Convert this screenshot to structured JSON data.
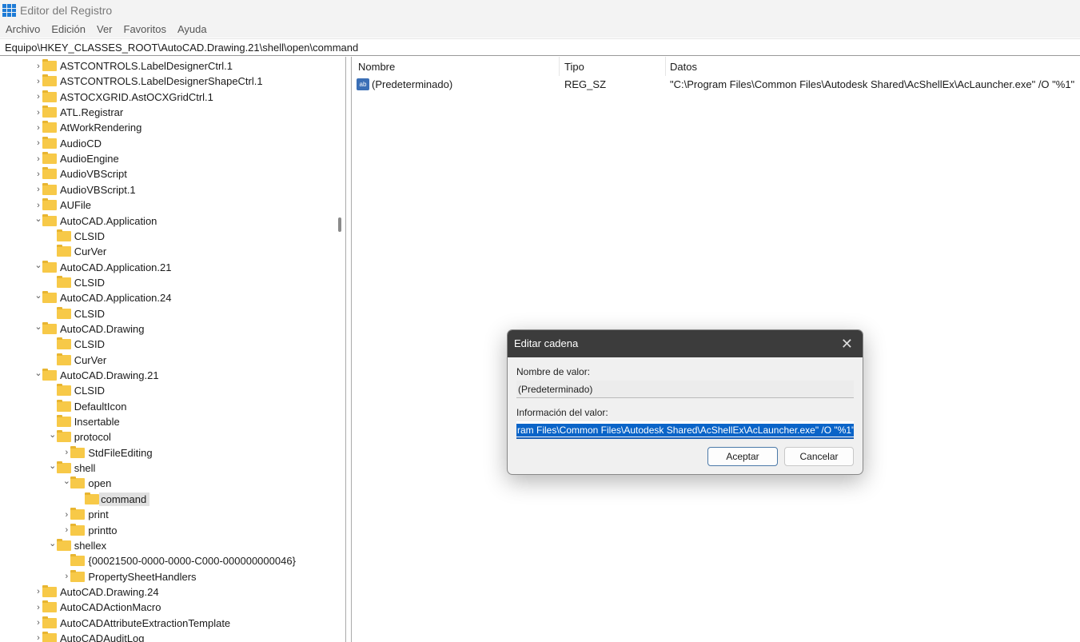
{
  "window": {
    "title": "Editor del Registro",
    "icon": "registry-icon"
  },
  "menu": [
    "Archivo",
    "Edición",
    "Ver",
    "Favoritos",
    "Ayuda"
  ],
  "address": "Equipo\\HKEY_CLASSES_ROOT\\AutoCAD.Drawing.21\\shell\\open\\command",
  "tree": [
    {
      "label": "ASTCONTROLS.LabelDesignerCtrl.1",
      "level": 0,
      "exp": ">"
    },
    {
      "label": "ASTCONTROLS.LabelDesignerShapeCtrl.1",
      "level": 0,
      "exp": ">"
    },
    {
      "label": "ASTOCXGRID.AstOCXGridCtrl.1",
      "level": 0,
      "exp": ">"
    },
    {
      "label": "ATL.Registrar",
      "level": 0,
      "exp": ">"
    },
    {
      "label": "AtWorkRendering",
      "level": 0,
      "exp": ">"
    },
    {
      "label": "AudioCD",
      "level": 0,
      "exp": ">"
    },
    {
      "label": "AudioEngine",
      "level": 0,
      "exp": ">"
    },
    {
      "label": "AudioVBScript",
      "level": 0,
      "exp": ">"
    },
    {
      "label": "AudioVBScript.1",
      "level": 0,
      "exp": ">"
    },
    {
      "label": "AUFile",
      "level": 0,
      "exp": ">"
    },
    {
      "label": "AutoCAD.Application",
      "level": 0,
      "exp": "v"
    },
    {
      "label": "CLSID",
      "level": 1,
      "exp": ""
    },
    {
      "label": "CurVer",
      "level": 1,
      "exp": ""
    },
    {
      "label": "AutoCAD.Application.21",
      "level": 0,
      "exp": "v"
    },
    {
      "label": "CLSID",
      "level": 1,
      "exp": ""
    },
    {
      "label": "AutoCAD.Application.24",
      "level": 0,
      "exp": "v"
    },
    {
      "label": "CLSID",
      "level": 1,
      "exp": ""
    },
    {
      "label": "AutoCAD.Drawing",
      "level": 0,
      "exp": "v"
    },
    {
      "label": "CLSID",
      "level": 1,
      "exp": ""
    },
    {
      "label": "CurVer",
      "level": 1,
      "exp": ""
    },
    {
      "label": "AutoCAD.Drawing.21",
      "level": 0,
      "exp": "v"
    },
    {
      "label": "CLSID",
      "level": 1,
      "exp": ""
    },
    {
      "label": "DefaultIcon",
      "level": 1,
      "exp": ""
    },
    {
      "label": "Insertable",
      "level": 1,
      "exp": ""
    },
    {
      "label": "protocol",
      "level": 1,
      "exp": "v"
    },
    {
      "label": "StdFileEditing",
      "level": 2,
      "exp": ">"
    },
    {
      "label": "shell",
      "level": 1,
      "exp": "v"
    },
    {
      "label": "open",
      "level": 2,
      "exp": "v"
    },
    {
      "label": "command",
      "level": 3,
      "exp": "",
      "selected": true
    },
    {
      "label": "print",
      "level": 2,
      "exp": ">"
    },
    {
      "label": "printto",
      "level": 2,
      "exp": ">"
    },
    {
      "label": "shellex",
      "level": 1,
      "exp": "v"
    },
    {
      "label": "{00021500-0000-0000-C000-000000000046}",
      "level": 2,
      "exp": ""
    },
    {
      "label": "PropertySheetHandlers",
      "level": 2,
      "exp": ">"
    },
    {
      "label": "AutoCAD.Drawing.24",
      "level": 0,
      "exp": ">"
    },
    {
      "label": "AutoCADActionMacro",
      "level": 0,
      "exp": ">"
    },
    {
      "label": "AutoCADAttributeExtractionTemplate",
      "level": 0,
      "exp": ">"
    },
    {
      "label": "AutoCADAuditLog",
      "level": 0,
      "exp": ">"
    }
  ],
  "list": {
    "columns": [
      "Nombre",
      "Tipo",
      "Datos"
    ],
    "rows": [
      {
        "name": "(Predeterminado)",
        "type": "REG_SZ",
        "data": "\"C:\\Program Files\\Common Files\\Autodesk Shared\\AcShellEx\\AcLauncher.exe\" /O \"%1\"",
        "icon": "ab"
      }
    ]
  },
  "dialog": {
    "title": "Editar cadena",
    "name_label": "Nombre de valor:",
    "name_value": "(Predeterminado)",
    "data_label": "Información del valor:",
    "data_value": "ram Files\\Common Files\\Autodesk Shared\\AcShellEx\\AcLauncher.exe\" /O \"%1\"",
    "ok": "Aceptar",
    "cancel": "Cancelar"
  }
}
